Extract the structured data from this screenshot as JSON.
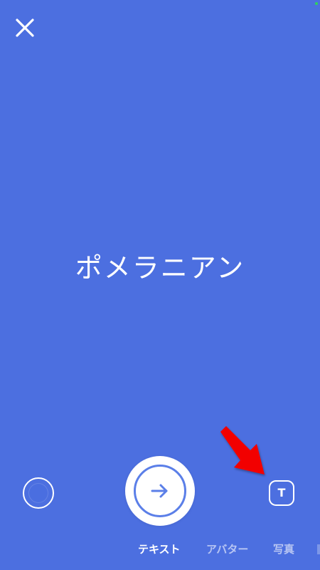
{
  "story": {
    "main_text": "ポメラニアン"
  },
  "controls": {
    "close_icon": "close-icon",
    "submit_icon": "arrow-right-icon",
    "text_style_label": "T"
  },
  "tabs": [
    {
      "label": "テキスト",
      "active": true
    },
    {
      "label": "アバター",
      "active": false
    },
    {
      "label": "写真",
      "active": false
    }
  ],
  "colors": {
    "background": "#4c6fe0",
    "accent": "#5b7fe8",
    "white": "#ffffff",
    "annotation_red": "#f20000"
  }
}
